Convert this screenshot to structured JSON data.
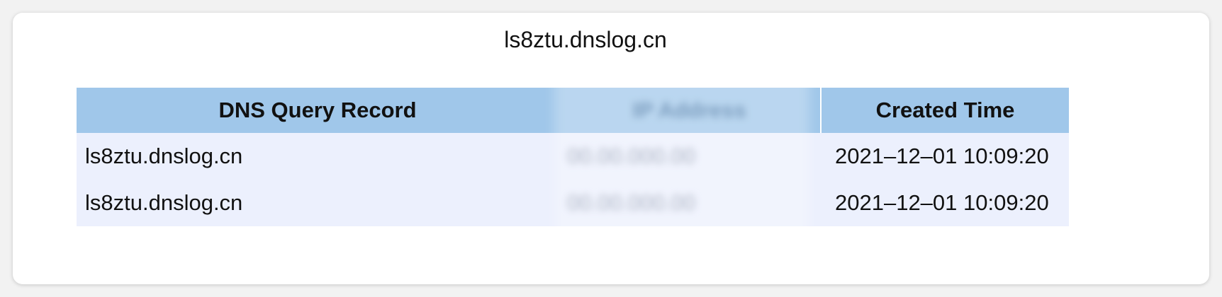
{
  "page": {
    "domain_title": "ls8ztu.dnslog.cn"
  },
  "table": {
    "headers": [
      "DNS Query Record",
      "IP Address",
      "Created Time"
    ],
    "rows": [
      {
        "record": "ls8ztu.dnslog.cn",
        "ip": "00.00.000.00",
        "time": "2021–12–01 10:09:20"
      },
      {
        "record": "ls8ztu.dnslog.cn",
        "ip": "00.00.000.00",
        "time": "2021–12–01 10:09:20"
      }
    ]
  },
  "colors": {
    "header_bg": "#a0c7ea",
    "row_bg": "#ecf0fd",
    "card_bg": "#ffffff"
  }
}
